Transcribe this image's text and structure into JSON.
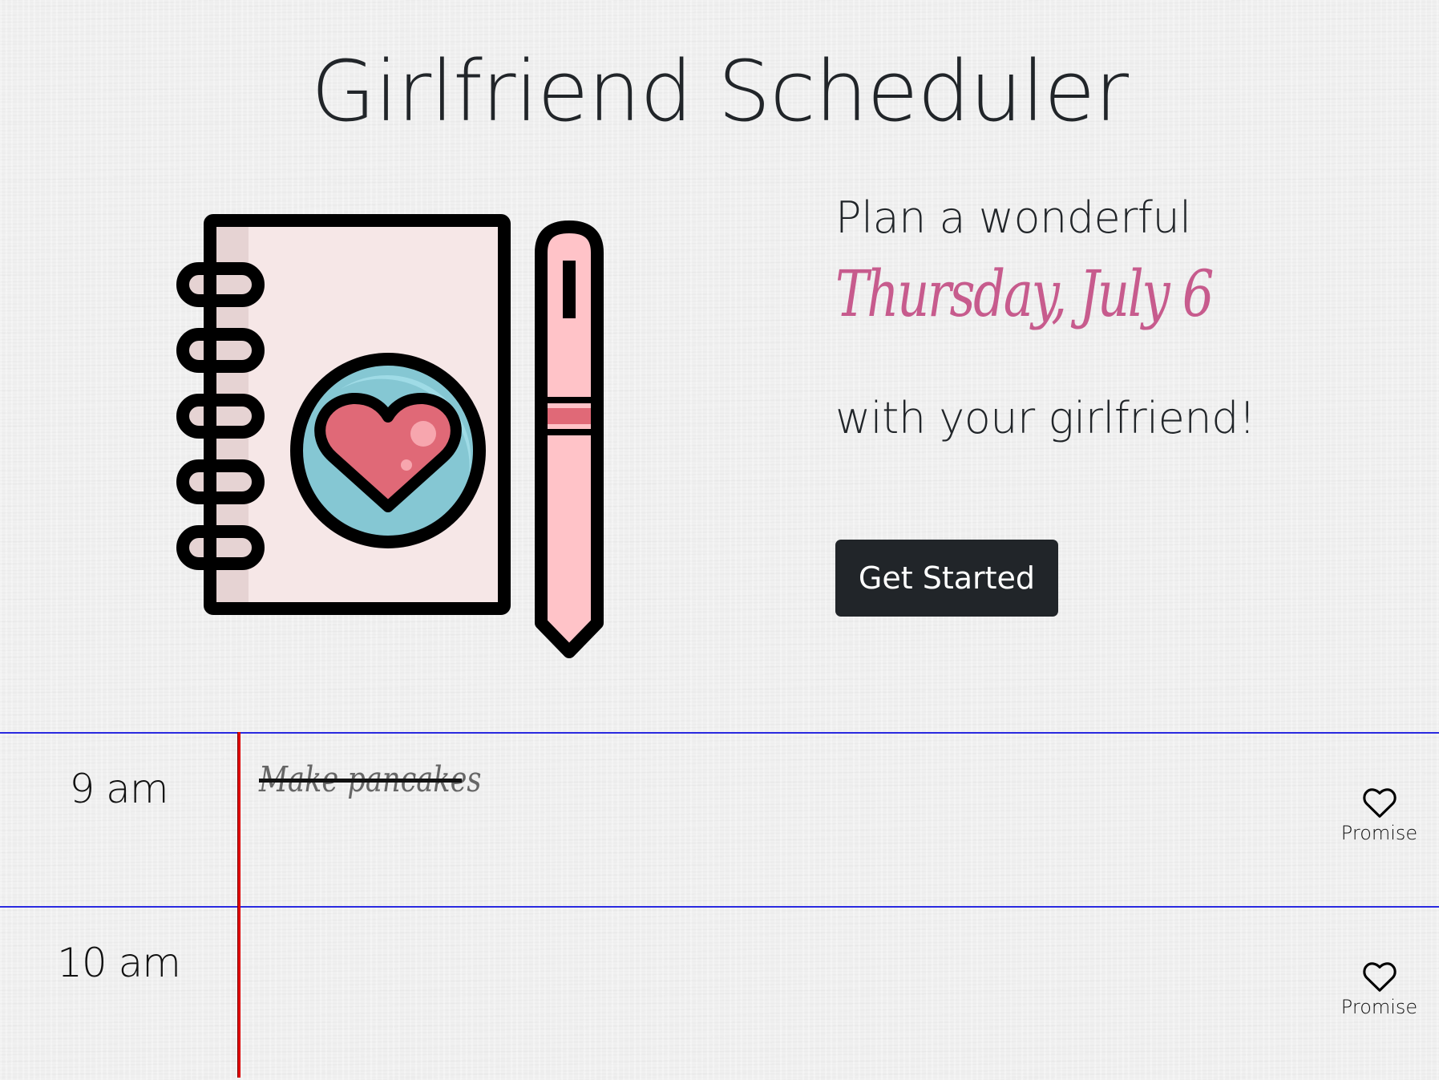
{
  "page": {
    "title": "Girlfriend Scheduler"
  },
  "hero": {
    "plan_prefix": "Plan a wonderful",
    "date": "Thursday, July 6",
    "plan_suffix": "with your girlfriend!",
    "cta_label": "Get Started",
    "illustration_icon": "notebook-heart-pen-illustration"
  },
  "colors": {
    "date_text": "#c75b8d",
    "cta_background": "#212529",
    "row_rule": "#2a2ae0",
    "margin_rule": "#e00000"
  },
  "schedule": {
    "rows": [
      {
        "hour": "9 am",
        "task": "Make pancakes",
        "task_completed": true,
        "action_label": "Promise",
        "action_icon": "heart-outline-icon"
      },
      {
        "hour": "10 am",
        "task": "",
        "task_completed": false,
        "action_label": "Promise",
        "action_icon": "heart-outline-icon"
      }
    ]
  }
}
